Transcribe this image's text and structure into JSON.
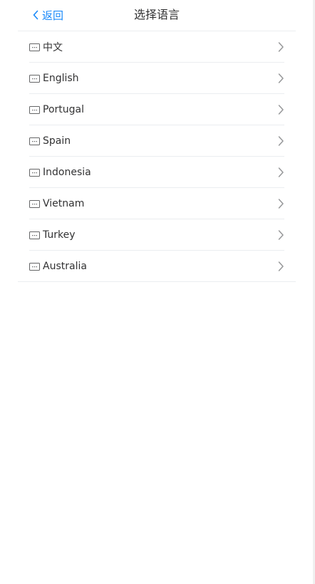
{
  "nav": {
    "back_label": "返回",
    "title": "选择语言"
  },
  "languages": [
    {
      "label": "中文"
    },
    {
      "label": "English"
    },
    {
      "label": "Portugal"
    },
    {
      "label": "Spain"
    },
    {
      "label": "Indonesia"
    },
    {
      "label": "Vietnam"
    },
    {
      "label": "Turkey"
    },
    {
      "label": "Australia"
    }
  ],
  "colors": {
    "accent": "#1989fa",
    "text": "#323233",
    "icon": "#646566",
    "chevron": "#969799",
    "divider": "#ebedf0"
  },
  "icons": {
    "back": "chevron-left-icon",
    "item": "keyboard-icon",
    "arrow": "chevron-right-icon"
  }
}
